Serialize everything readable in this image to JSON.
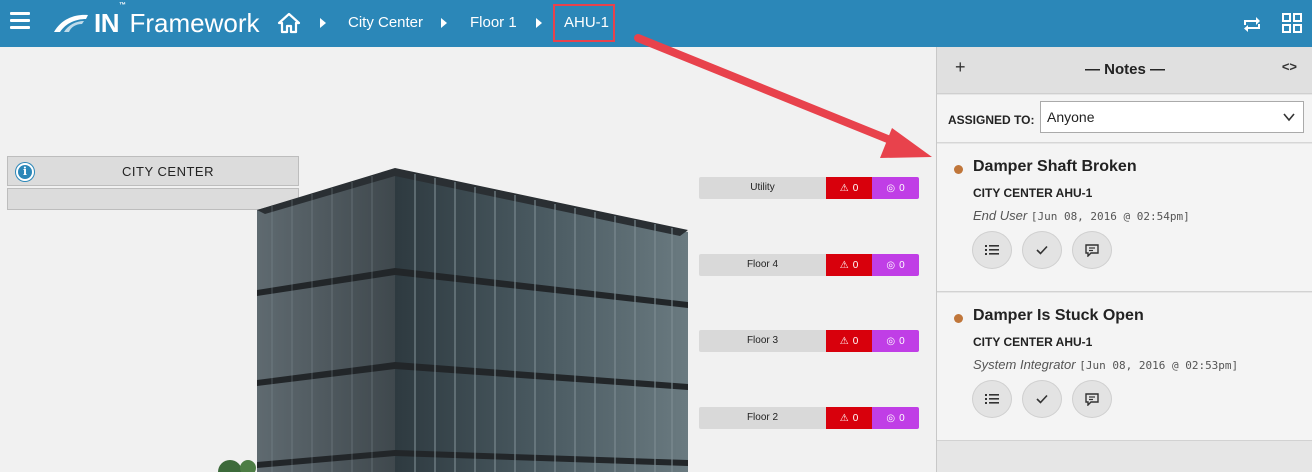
{
  "app": {
    "logo_in": "IN",
    "logo_tm": "™",
    "logo_framework": "Framework"
  },
  "breadcrumbs": [
    "City Center",
    "Floor 1",
    "AHU-1"
  ],
  "info_panel": {
    "title": "CITY CENTER"
  },
  "floors": [
    {
      "name": "Utility",
      "alarms": "0",
      "notes": "0"
    },
    {
      "name": "Floor 4",
      "alarms": "0",
      "notes": "0"
    },
    {
      "name": "Floor 3",
      "alarms": "0",
      "notes": "0"
    },
    {
      "name": "Floor 2",
      "alarms": "0",
      "notes": "0"
    }
  ],
  "notes_panel": {
    "add_label": "+",
    "title": "— Notes —",
    "toggle_label": "<>",
    "assigned_label": "ASSIGNED TO:",
    "assigned_value": "Anyone",
    "items": [
      {
        "title": "Damper Shaft Broken",
        "location": "CITY CENTER AHU-1",
        "user": "End User",
        "timestamp": "[Jun 08, 2016 @ 02:54pm]"
      },
      {
        "title": "Damper Is Stuck Open",
        "location": "CITY CENTER AHU-1",
        "user": "System Integrator",
        "timestamp": "[Jun 08, 2016 @ 02:53pm]"
      }
    ]
  },
  "colors": {
    "topbar": "#2b87b8",
    "alarm": "#d8000c",
    "note_badge": "#c03ee6",
    "note_dot": "#c0763a",
    "highlight": "#e8424c"
  }
}
